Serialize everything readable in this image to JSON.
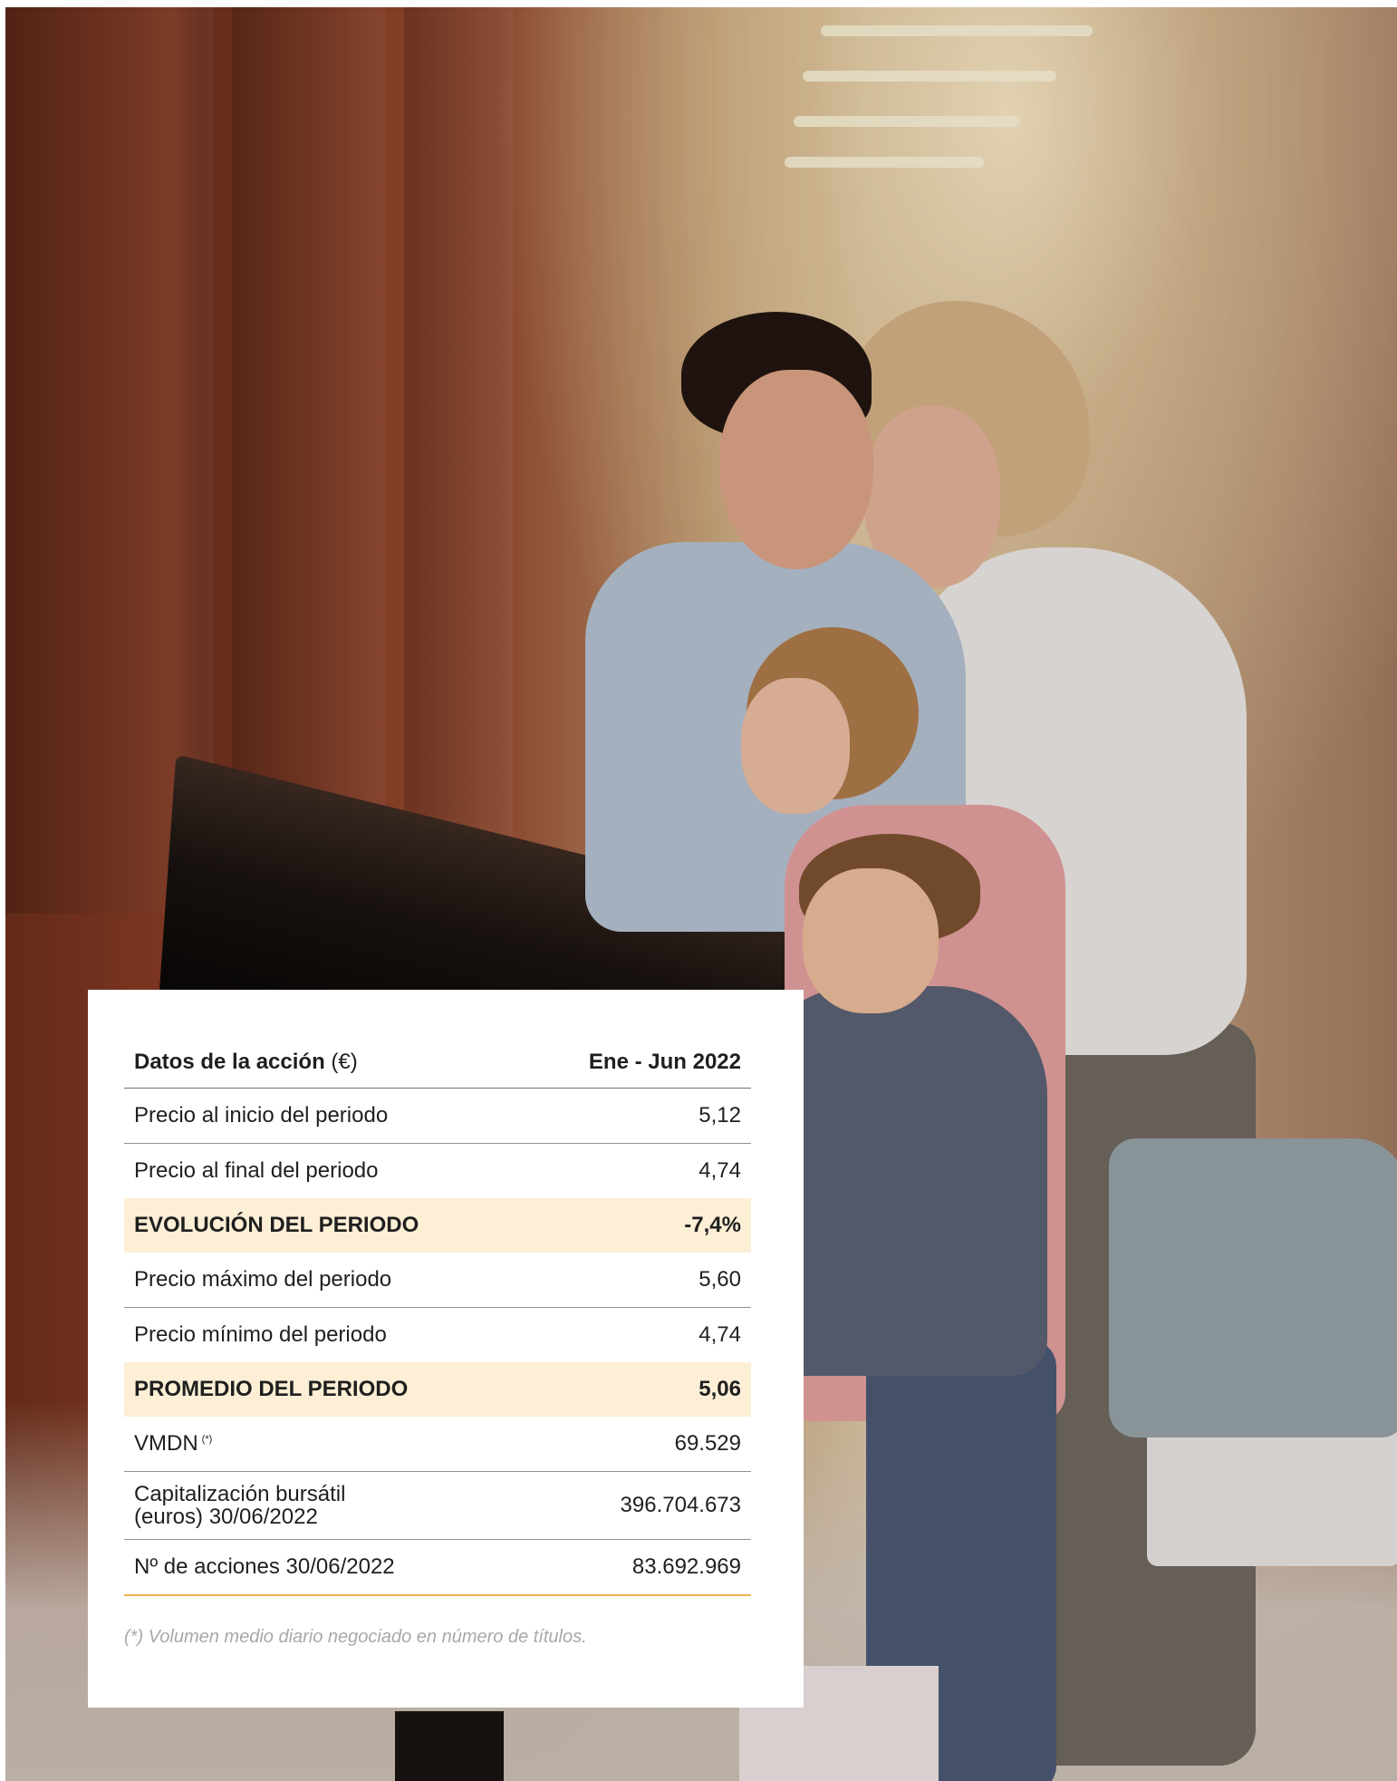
{
  "table": {
    "header": {
      "label": "Datos de la acción",
      "unit": "(€)",
      "period": "Ene - Jun 2022"
    },
    "rows": [
      {
        "label": "Precio al inicio del periodo",
        "value": "5,12"
      },
      {
        "label": "Precio al final del periodo",
        "value": "4,74"
      },
      {
        "label": "EVOLUCIÓN DEL PERIODO",
        "value": "-7,4%",
        "highlight": true
      },
      {
        "label": "Precio máximo del periodo",
        "value": "5,60"
      },
      {
        "label": "Precio mínimo del periodo",
        "value": "4,74"
      },
      {
        "label": "PROMEDIO DEL PERIODO",
        "value": "5,06",
        "highlight": true
      },
      {
        "label": "VMDN",
        "marker": "(*)",
        "value": "69.529"
      },
      {
        "label_line1": "Capitalización bursátil",
        "label_line2": "(euros) 30/06/2022",
        "value": "396.704.673"
      },
      {
        "label": "Nº de acciones 30/06/2022",
        "value": "83.692.969"
      }
    ]
  },
  "footnote": "(*) Volumen medio diario negociado en número de títulos.",
  "colors": {
    "highlight_row": "#fcefd6",
    "bottom_rule": "#f1b24a",
    "footnote_text": "#a8a8a8"
  }
}
